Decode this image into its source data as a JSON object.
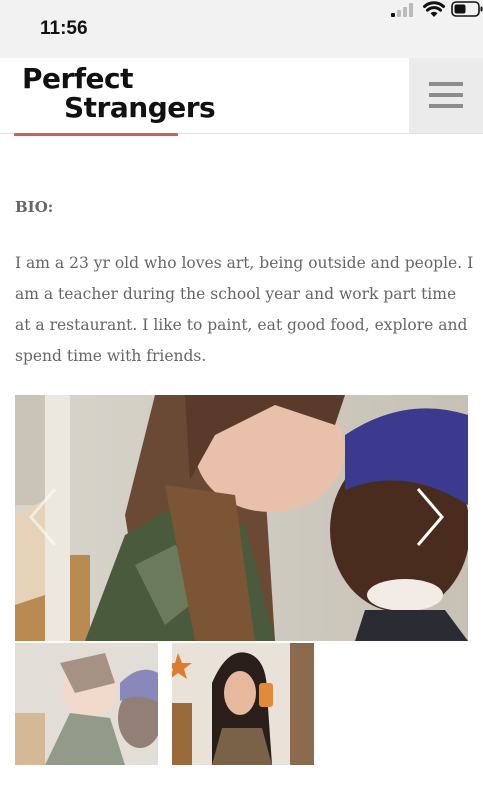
{
  "status_bar": {
    "time": "11:56",
    "icons": [
      "signal-icon",
      "wifi-icon",
      "battery-icon"
    ]
  },
  "header": {
    "logo_line1": "Perfect",
    "logo_line2": "Strangers",
    "menu_icon": "hamburger-menu-icon"
  },
  "colors": {
    "accent": "#c9625b",
    "text": "#666666",
    "status_bg": "#f2f2f2",
    "menu_bg": "#ebebeb"
  },
  "bio": {
    "heading": "BIO:",
    "text": "I am a 23 yr old who loves art, being outside and people. I am a teacher during the school year and work part time at a restaurant. I like to paint, eat good food, explore and spend time with friends."
  },
  "gallery": {
    "prev_icon": "chevron-left-icon",
    "next_icon": "chevron-right-icon",
    "thumbnail_count": 2
  }
}
